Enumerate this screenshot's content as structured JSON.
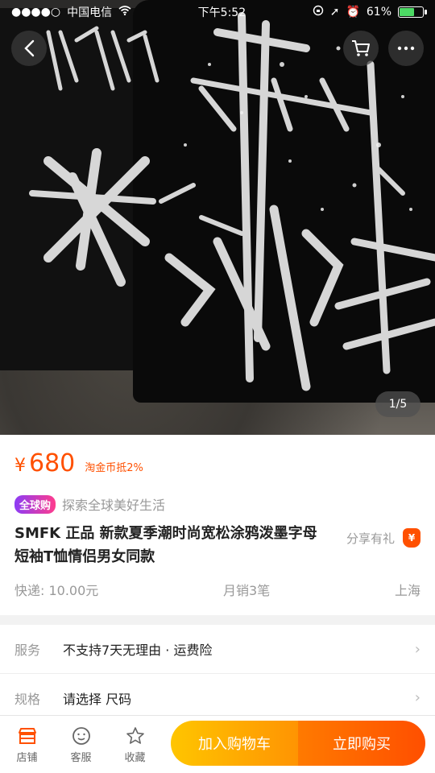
{
  "status_bar": {
    "carrier": "中国电信",
    "time": "下午5:52",
    "battery": "61%",
    "battery_level": 0.61
  },
  "gallery": {
    "pager": "1/5"
  },
  "product": {
    "currency": "¥",
    "price": "680",
    "coin_discount": "淘金币抵2%",
    "global_badge": "全球购",
    "global_slogan": "探索全球美好生活",
    "title": "SMFK 正品 新款夏季潮时尚宽松涂鸦泼墨字母短袖T恤情侣男女同款",
    "share_label": "分享有礼",
    "share_icon": "¥",
    "shipping": "快递: 10.00元",
    "monthly_sales": "月销3笔",
    "location": "上海"
  },
  "rows": [
    {
      "label": "服务",
      "value": "不支持7天无理由 · 运费险"
    },
    {
      "label": "规格",
      "value": "请选择 尺码"
    }
  ],
  "bottom_bar": {
    "store_label": "店铺",
    "service_label": "客服",
    "favorite_label": "收藏",
    "add_to_cart": "加入购物车",
    "buy_now": "立即购买"
  },
  "colors": {
    "accent": "#ff5000",
    "cart_button": "#ffa200",
    "buy_button": "#ff5000"
  }
}
